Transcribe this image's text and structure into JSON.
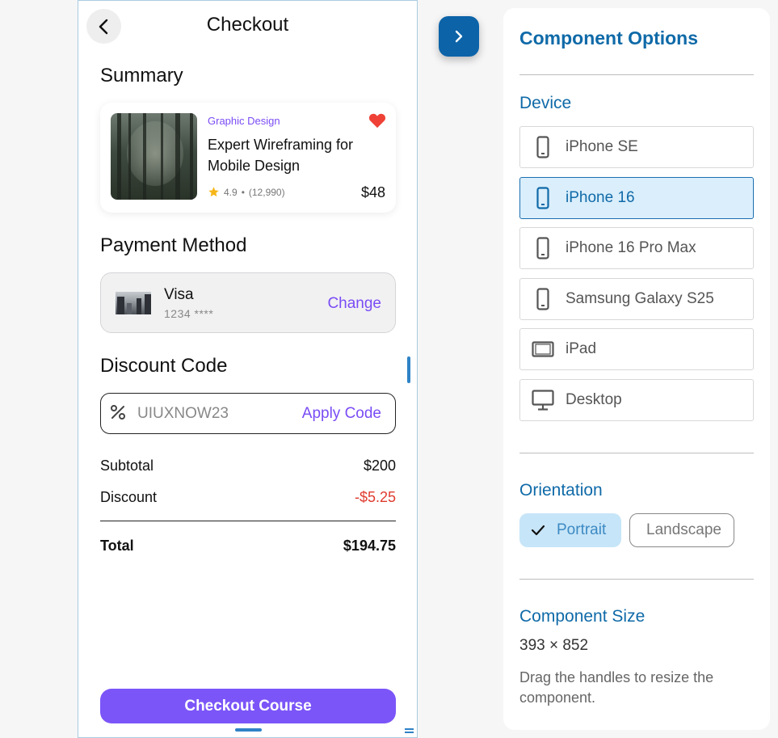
{
  "checkout": {
    "title": "Checkout",
    "summary_heading": "Summary",
    "course": {
      "category": "Graphic Design",
      "name": "Expert Wireframing for Mobile Design",
      "rating": "4.9",
      "reviews": "(12,990)",
      "price": "$48"
    },
    "payment_heading": "Payment Method",
    "payment": {
      "card_name": "Visa",
      "card_number": "1234 ****",
      "change_label": "Change"
    },
    "discount_heading": "Discount Code",
    "discount": {
      "value": "UIUXNOW23",
      "apply_label": "Apply Code"
    },
    "totals": {
      "subtotal_label": "Subtotal",
      "subtotal_value": "$200",
      "discount_label": "Discount",
      "discount_value": "-$5.25",
      "total_label": "Total",
      "total_value": "$194.75"
    },
    "checkout_button": "Checkout Course",
    "colors": {
      "accent": "#7b55f8",
      "discount_red": "#e03b2f",
      "heart": "#ef4136"
    }
  },
  "panel": {
    "title": "Component Options",
    "device_heading": "Device",
    "devices": [
      {
        "label": "iPhone SE",
        "icon": "phone-icon",
        "selected": false
      },
      {
        "label": "iPhone 16",
        "icon": "phone-icon",
        "selected": true
      },
      {
        "label": "iPhone 16 Pro Max",
        "icon": "phone-icon",
        "selected": false
      },
      {
        "label": "Samsung Galaxy S25",
        "icon": "phone-icon",
        "selected": false
      },
      {
        "label": "iPad",
        "icon": "tablet-icon",
        "selected": false
      },
      {
        "label": "Desktop",
        "icon": "monitor-icon",
        "selected": false
      }
    ],
    "orientation_heading": "Orientation",
    "orientation": {
      "portrait": "Portrait",
      "landscape": "Landscape",
      "selected": "portrait"
    },
    "size_heading": "Component Size",
    "size_value": "393 × 852",
    "size_help": "Drag the handles to resize the component.",
    "colors": {
      "primary": "#0f6aa8",
      "selected_bg": "#daeefb"
    }
  }
}
